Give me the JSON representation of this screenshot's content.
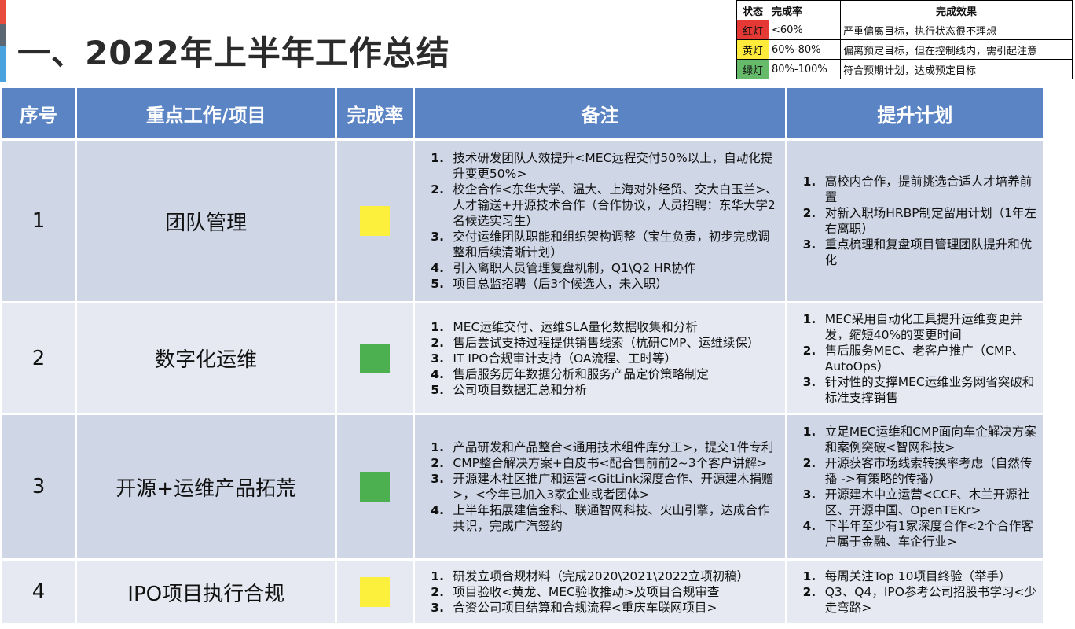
{
  "title": "一、2022年上半年工作总结",
  "legend": {
    "headers": [
      "状态",
      "完成率",
      "完成效果"
    ],
    "rows": [
      {
        "state": "红灯",
        "rate": "<60%",
        "effect": "严重偏离目标，执行状态很不理想",
        "color": "#e53935"
      },
      {
        "state": "黄灯",
        "rate": "60%-80%",
        "effect": "偏离预定目标，但在控制线内，需引起注意",
        "color": "#ffeb3b"
      },
      {
        "state": "绿灯",
        "rate": "80%-100%",
        "effect": "符合预期计划，达成预定目标",
        "color": "#66bb6a"
      }
    ]
  },
  "table": {
    "headers": [
      "序号",
      "重点工作/项目",
      "完成率",
      "备注",
      "提升计划"
    ],
    "rows": [
      {
        "no": "1",
        "project": "团队管理",
        "status": "yellow",
        "notes": [
          "技术研发团队人效提升<MEC远程交付50%以上，自动化提升变更50%>",
          "校企合作<东华大学、温大、上海对外经贸、交大白玉兰>、人才输送+开源技术合作（合作协议，人员招聘：东华大学2名候选实习生）",
          "交付运维团队职能和组织架构调整（宝生负责，初步完成调整和后续清晰计划）",
          "引入离职人员管理复盘机制，Q1\\Q2 HR协作",
          "项目总监招聘（后3个候选人，未入职）"
        ],
        "plans": [
          "高校内合作，提前挑选合适人才培养前置",
          "对新入职场HRBP制定留用计划（1年左右离职）",
          "重点梳理和复盘项目管理团队提升和优化"
        ]
      },
      {
        "no": "2",
        "project": "数字化运维",
        "status": "green",
        "notes": [
          "MEC运维交付、运维SLA量化数据收集和分析",
          "售后尝试支持过程提供销售线索（杭研CMP、运维续保）",
          "IT IPO合规审计支持（OA流程、工时等）",
          "售后服务历年数据分析和服务产品定价策略制定",
          "公司项目数据汇总和分析"
        ],
        "plans": [
          "MEC采用自动化工具提升运维变更并发，缩短40%的变更时间",
          "售后服务MEC、老客户推广（CMP、AutoOps）",
          "针对性的支撑MEC运维业务网省突破和标准支撑销售"
        ]
      },
      {
        "no": "3",
        "project": "开源+运维产品拓荒",
        "status": "green",
        "notes": [
          "产品研发和产品整合<通用技术组件库分工>，提交1件专利",
          "CMP整合解决方案+白皮书<配合售前前2~3个客户讲解>",
          "开源建木社区推广和运营<GitLink深度合作、开源建木捐赠>，<今年已加入3家企业或者团体>",
          "上半年拓展建信金科、联通智网科技、火山引擎，达成合作共识，完成广汽签约"
        ],
        "plans": [
          "立足MEC运维和CMP面向车企解决方案和案例突破<智网科技>",
          "开源获客市场线索转换率考虑（自然传播 ->有策略的传播）",
          "开源建木中立运营<CCF、木兰开源社区、开源中国、OpenTEKr>",
          "下半年至少有1家深度合作<2个合作客户属于金融、车企行业>"
        ]
      },
      {
        "no": "4",
        "project": "IPO项目执行合规",
        "status": "yellow",
        "notes": [
          "研发立项合规材料（完成2020\\2021\\2022立项初稿）",
          "项目验收<黄龙、MEC验收推动>及项目合规审查",
          "合资公司项目结算和合规流程<重庆车联网项目>"
        ],
        "plans": [
          "每周关注Top 10项目终验（举手）",
          "Q3、Q4，IPO参考公司招股书学习<少走弯路>"
        ]
      }
    ]
  }
}
